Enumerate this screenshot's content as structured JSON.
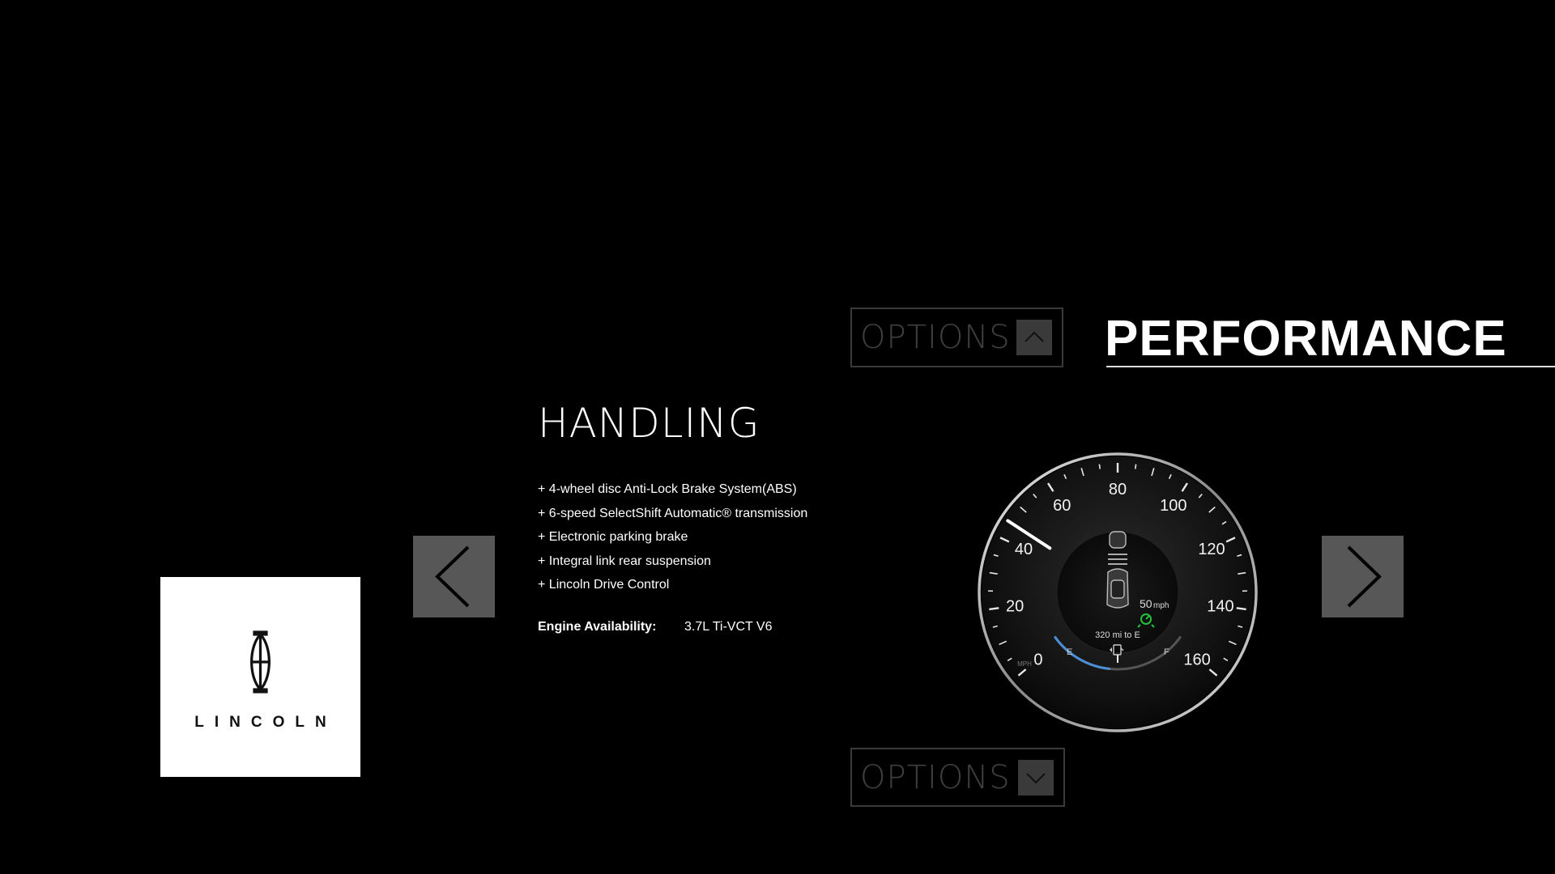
{
  "header": {
    "section_title": "PERFORMANCE",
    "options_top_label": "OPTIONS",
    "options_bottom_label": "OPTIONS"
  },
  "content": {
    "heading": "HANDLING",
    "features": [
      "+ 4-wheel disc Anti-Lock Brake System(ABS)",
      "+ 6-speed SelectShift Automatic® transmission",
      "+ Electronic parking brake",
      "+ Integral link rear suspension",
      "+ Lincoln Drive Control"
    ],
    "engine_label": "Engine Availability:",
    "engine_value": "3.7L Ti-VCT V6"
  },
  "logo": {
    "wordmark": "LINCOLN"
  },
  "gauge": {
    "tick_labels": [
      "0",
      "20",
      "40",
      "60",
      "80",
      "100",
      "120",
      "140",
      "160"
    ],
    "unit": "MPH",
    "speed_value": "50",
    "speed_unit": "mph",
    "range_text": "320 mi to E",
    "fuel_empty_label": "E",
    "fuel_full_label": "F",
    "needle_speed": 45,
    "fuel_level": 0.45
  },
  "icons": {
    "options_top_arrow": "chevron-up-icon",
    "options_bottom_arrow": "chevron-down-icon",
    "nav_prev": "chevron-left-icon",
    "nav_next": "chevron-right-icon",
    "fuel": "fuel-pump-icon",
    "cruise": "cruise-control-icon"
  },
  "colors": {
    "background": "#000000",
    "button_bg": "#575757",
    "options_border": "#3a3a3a",
    "options_text": "#3f3f3f",
    "accent_green": "#22c23a",
    "fuel_blue": "#4a8fd6"
  }
}
